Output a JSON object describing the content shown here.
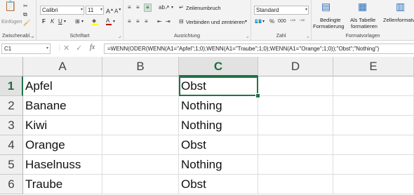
{
  "ribbon": {
    "clipboard": {
      "paste_label": "Einfügen",
      "group_label": "Zwischenabl..."
    },
    "font": {
      "family": "Calibri",
      "size": "11",
      "bold": "F",
      "italic": "K",
      "underline": "U",
      "group_label": "Schriftart"
    },
    "alignment": {
      "wrap_label": "Zeilenumbruch",
      "merge_label": "Verbinden und zentrieren",
      "group_label": "Ausrichtung"
    },
    "number": {
      "format": "Standard",
      "percent": "%",
      "thousands": "000",
      "group_label": "Zahl"
    },
    "styles": {
      "conditional_line1": "Bedingte",
      "conditional_line2": "Formatierung",
      "table_line1": "Als Tabelle",
      "table_line2": "formatieren",
      "cell_styles_line1": "Zellenformatvor",
      "group_label": "Formatvorlagen"
    }
  },
  "formula_bar": {
    "name_box": "C1",
    "fx_label": "fx",
    "formula": "=WENN(ODER(WENN(A1=\"Apfel\";1;0);WENN(A1=\"Traube\";1;0);WENN(A1=\"Orange\";1;0));\"Obst\";\"Nothing\")"
  },
  "sheet": {
    "columns": [
      "A",
      "B",
      "C",
      "D",
      "E"
    ],
    "rows": [
      {
        "num": "1",
        "a": "Apfel",
        "c": "Obst"
      },
      {
        "num": "2",
        "a": "Banane",
        "c": "Nothing"
      },
      {
        "num": "3",
        "a": "Kiwi",
        "c": "Nothing"
      },
      {
        "num": "4",
        "a": "Orange",
        "c": "Obst"
      },
      {
        "num": "5",
        "a": "Haselnuss",
        "c": "Nothing"
      },
      {
        "num": "6",
        "a": "Traube",
        "c": "Obst"
      }
    ],
    "active_cell": "C1"
  },
  "colors": {
    "accent": "#217346",
    "font_color": "#c00000",
    "highlight": "#ffff00"
  }
}
